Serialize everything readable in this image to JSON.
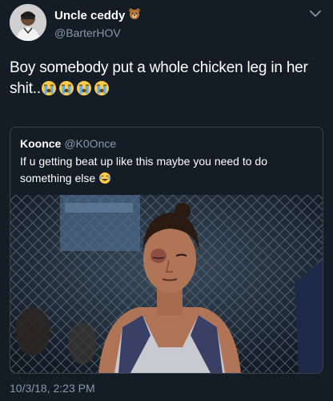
{
  "author": {
    "name": "Uncle ceddy",
    "name_emoji": "bear-face-icon",
    "handle": "@BarterHOV"
  },
  "tweet": {
    "text": "Boy somebody put a whole chicken leg in her shit..",
    "emojis": [
      "loudly-crying-face-icon",
      "loudly-crying-face-icon",
      "loudly-crying-face-icon",
      "loudly-crying-face-icon"
    ]
  },
  "quoted_tweet": {
    "name": "Koonce",
    "handle": "@K0Once",
    "text": "If u getting beat up like this maybe you need to do something else",
    "emoji": "face-with-tears-of-joy-icon"
  },
  "timestamp": "10/3/18, 2:23 PM",
  "colors": {
    "background": "#141d26",
    "secondary_text": "#8899a6",
    "border": "#38444d"
  }
}
